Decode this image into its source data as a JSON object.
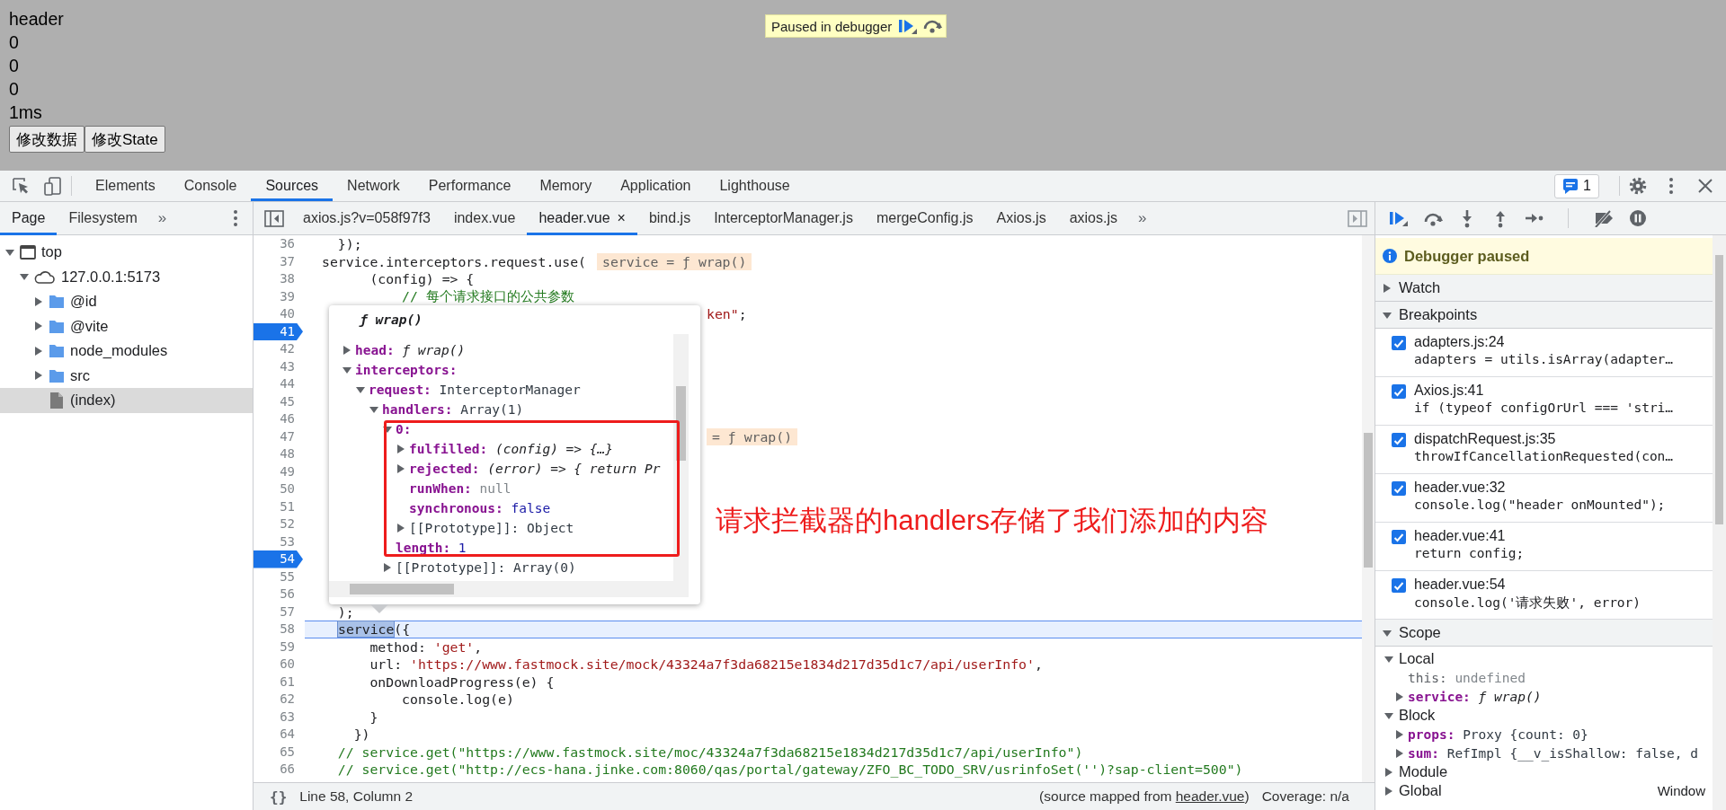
{
  "page": {
    "lines": [
      "header",
      "0",
      "0",
      "0",
      "1ms"
    ],
    "buttons": [
      "修改数据",
      "修改State"
    ],
    "paused_overlay": {
      "text": "Paused in debugger"
    }
  },
  "devtools": {
    "tabs": [
      {
        "label": "Elements",
        "selected": false
      },
      {
        "label": "Console",
        "selected": false
      },
      {
        "label": "Sources",
        "selected": true
      },
      {
        "label": "Network",
        "selected": false
      },
      {
        "label": "Performance",
        "selected": false
      },
      {
        "label": "Memory",
        "selected": false
      },
      {
        "label": "Application",
        "selected": false
      },
      {
        "label": "Lighthouse",
        "selected": false
      }
    ],
    "issues_count": "1"
  },
  "navigator": {
    "tabs": [
      {
        "label": "Page",
        "selected": true
      },
      {
        "label": "Filesystem",
        "selected": false
      }
    ],
    "more": "»",
    "tree": [
      {
        "label": "top",
        "kind": "frame",
        "expanded": true,
        "selected": false,
        "children": [
          {
            "label": "127.0.0.1:5173",
            "kind": "origin",
            "expanded": true,
            "selected": false,
            "children": [
              {
                "label": "@id",
                "kind": "folder",
                "expanded": false,
                "selected": false
              },
              {
                "label": "@vite",
                "kind": "folder",
                "expanded": false,
                "selected": false
              },
              {
                "label": "node_modules",
                "kind": "folder",
                "expanded": false,
                "selected": false
              },
              {
                "label": "src",
                "kind": "folder",
                "expanded": false,
                "selected": false
              },
              {
                "label": "(index)",
                "kind": "file",
                "selected": true
              }
            ]
          }
        ]
      }
    ]
  },
  "editor": {
    "tabs": [
      {
        "label": "axios.js?v=058f97f3",
        "selected": false
      },
      {
        "label": "index.vue",
        "selected": false
      },
      {
        "label": "header.vue",
        "selected": true,
        "close": "×"
      },
      {
        "label": "bind.js",
        "selected": false
      },
      {
        "label": "InterceptorManager.js",
        "selected": false
      },
      {
        "label": "mergeConfig.js",
        "selected": false
      },
      {
        "label": "Axios.js",
        "selected": false
      },
      {
        "label": "axios.js",
        "selected": false
      }
    ],
    "more": "»",
    "lines": [
      {
        "n": "36",
        "breakpoint": false,
        "current": false,
        "covered": false,
        "segments": [
          {
            "text": "  });",
            "kind": "plain"
          }
        ]
      },
      {
        "n": "37",
        "breakpoint": false,
        "current": false,
        "covered": false,
        "segments": [
          {
            "text": "service.interceptors.request.use(",
            "kind": "plain"
          }
        ],
        "inline_value": "service = ƒ wrap()"
      },
      {
        "n": "38",
        "breakpoint": false,
        "current": false,
        "covered": false,
        "segments": [
          {
            "text": "      (config) => {",
            "kind": "plain"
          }
        ]
      },
      {
        "n": "39",
        "breakpoint": false,
        "current": false,
        "covered": false,
        "segments": [
          {
            "text": "          // 每个请求接口的公共参数",
            "kind": "comment"
          }
        ]
      },
      {
        "n": "40",
        "breakpoint": false,
        "current": false,
        "covered": true,
        "segments": [
          {
            "text": "ken\"",
            "kind": "string"
          },
          {
            "text": ";",
            "kind": "plain"
          }
        ]
      },
      {
        "n": "41",
        "breakpoint": true,
        "current": false
      },
      {
        "n": "42",
        "breakpoint": false,
        "current": false
      },
      {
        "n": "43",
        "breakpoint": false,
        "current": false
      },
      {
        "n": "44",
        "breakpoint": false,
        "current": false
      },
      {
        "n": "45",
        "breakpoint": false,
        "current": false
      },
      {
        "n": "46",
        "breakpoint": false,
        "current": false
      },
      {
        "n": "47",
        "breakpoint": false,
        "current": false,
        "covered": true,
        "inline_value": "= ƒ wrap()"
      },
      {
        "n": "48",
        "breakpoint": false,
        "current": false
      },
      {
        "n": "49",
        "breakpoint": false,
        "current": false
      },
      {
        "n": "50",
        "breakpoint": false,
        "current": false
      },
      {
        "n": "51",
        "breakpoint": false,
        "current": false
      },
      {
        "n": "52",
        "breakpoint": false,
        "current": false
      },
      {
        "n": "53",
        "breakpoint": false,
        "current": false
      },
      {
        "n": "54",
        "breakpoint": true,
        "current": false
      },
      {
        "n": "55",
        "breakpoint": false,
        "current": false
      },
      {
        "n": "56",
        "breakpoint": false,
        "current": false
      },
      {
        "n": "57",
        "breakpoint": false,
        "current": false,
        "covered": false,
        "segments": [
          {
            "text": "  );",
            "kind": "plain"
          }
        ]
      },
      {
        "n": "58",
        "breakpoint": false,
        "current": true,
        "covered": false,
        "segments": [
          {
            "text": "service",
            "kind": "selection"
          },
          {
            "text": "({",
            "kind": "plain"
          }
        ]
      },
      {
        "n": "59",
        "breakpoint": false,
        "current": false,
        "covered": false,
        "segments": [
          {
            "text": "      method: ",
            "kind": "plain"
          },
          {
            "text": "'get'",
            "kind": "string"
          },
          {
            "text": ",",
            "kind": "plain"
          }
        ]
      },
      {
        "n": "60",
        "breakpoint": false,
        "current": false,
        "covered": false,
        "segments": [
          {
            "text": "      url: ",
            "kind": "plain"
          },
          {
            "text": "'https://www.fastmock.site/mock/43324a7f3da68215e1834d217d35d1c7/api/userInfo'",
            "kind": "string"
          },
          {
            "text": ",",
            "kind": "plain"
          }
        ]
      },
      {
        "n": "61",
        "breakpoint": false,
        "current": false,
        "covered": false,
        "segments": [
          {
            "text": "      onDownloadProgress(e) {",
            "kind": "plain"
          }
        ]
      },
      {
        "n": "62",
        "breakpoint": false,
        "current": false,
        "covered": false,
        "segments": [
          {
            "text": "          console.log(e)",
            "kind": "plain"
          }
        ]
      },
      {
        "n": "63",
        "breakpoint": false,
        "current": false,
        "covered": false,
        "segments": [
          {
            "text": "      }",
            "kind": "plain"
          }
        ]
      },
      {
        "n": "64",
        "breakpoint": false,
        "current": false,
        "covered": false,
        "segments": [
          {
            "text": "    })",
            "kind": "plain"
          }
        ]
      },
      {
        "n": "65",
        "breakpoint": false,
        "current": false,
        "covered": false,
        "segments": [
          {
            "text": "  // service.get(\"https://www.fastmock.site/moc/43324a7f3da68215e1834d217d35d1c7/api/userInfo\")",
            "kind": "comment"
          }
        ]
      },
      {
        "n": "66",
        "breakpoint": false,
        "current": false,
        "covered": false,
        "segments": [
          {
            "text": "  // service.get(\"http://ecs-hana.jinke.com:8060/qas/portal/gateway/ZFO_BC_TODO_SRV/usrinfoSet('')?sap-client=500\")",
            "kind": "comment"
          }
        ]
      }
    ],
    "popover": {
      "title": "ƒ wrap()",
      "items": [
        {
          "key": "head:",
          "value": "ƒ wrap()",
          "kind": "function",
          "expanded": false
        },
        {
          "key": "interceptors:",
          "kind": "object",
          "expanded": true,
          "children": [
            {
              "key": "request:",
              "value": "InterceptorManager",
              "kind": "text",
              "expanded": true,
              "children": [
                {
                  "key": "handlers:",
                  "value": "Array(1)",
                  "kind": "text",
                  "expanded": true,
                  "children": [
                    {
                      "key": "0:",
                      "kind": "object",
                      "expanded": true,
                      "children": [
                        {
                          "key": "fulfilled:",
                          "value": "(config) => {…}",
                          "kind": "function",
                          "expanded": false
                        },
                        {
                          "key": "rejected:",
                          "value": "(error) => { return Pr",
                          "kind": "function",
                          "expanded": false
                        },
                        {
                          "key": "runWhen:",
                          "value": "null",
                          "kind": "null"
                        },
                        {
                          "key": "synchronous:",
                          "value": "false",
                          "kind": "boolean"
                        },
                        {
                          "key": "[[Prototype]]:",
                          "value": "Object",
                          "kind": "internal",
                          "expanded": false
                        }
                      ]
                    },
                    {
                      "key": "length:",
                      "value": "1",
                      "kind": "number"
                    },
                    {
                      "key": "[[Prototype]]:",
                      "value": "Array(0)",
                      "kind": "internal",
                      "expanded": false
                    }
                  ]
                }
              ]
            }
          ]
        }
      ]
    },
    "annotation": "请求拦截器的handlers存储了我们添加的内容"
  },
  "status_bar": {
    "pretty_print": "{}",
    "position": "Line 58, Column 2",
    "source_prefix": "(source mapped from ",
    "source_link": "header.vue",
    "source_suffix": ")",
    "coverage": "Coverage: n/a"
  },
  "debugger": {
    "banner": "Debugger paused",
    "panes": [
      {
        "kind": "watch",
        "title": "Watch",
        "expanded": false
      },
      {
        "kind": "breakpoints",
        "title": "Breakpoints",
        "expanded": true,
        "items": [
          {
            "location": "adapters.js:24",
            "code": "adapters = utils.isArray(adapter…",
            "checked": true
          },
          {
            "location": "Axios.js:41",
            "code": "if (typeof configOrUrl === 'stri…",
            "checked": true
          },
          {
            "location": "dispatchRequest.js:35",
            "code": "throwIfCancellationRequested(con…",
            "checked": true
          },
          {
            "location": "header.vue:32",
            "code": "console.log(\"header onMounted\");",
            "checked": true
          },
          {
            "location": "header.vue:41",
            "code": "return config;",
            "checked": true
          },
          {
            "location": "header.vue:54",
            "code": "console.log('请求失败', error)",
            "checked": true
          }
        ]
      },
      {
        "kind": "scope",
        "title": "Scope",
        "expanded": true,
        "groups": [
          {
            "title": "Local",
            "expanded": true,
            "items": [
              {
                "key": "this:",
                "value": "undefined",
                "kind": "undefined"
              },
              {
                "key": "service:",
                "value": "ƒ wrap()",
                "kind": "function",
                "expanded": false
              }
            ]
          },
          {
            "title": "Block",
            "expanded": true,
            "items": [
              {
                "key": "props:",
                "value": "Proxy {count: 0}",
                "kind": "text",
                "expanded": false
              },
              {
                "key": "sum:",
                "value": "RefImpl {__v_isShallow: false, d",
                "kind": "text",
                "expanded": false
              }
            ]
          },
          {
            "title": "Module",
            "expanded": false
          },
          {
            "title": "Global",
            "expanded": false,
            "value": "Window"
          }
        ]
      }
    ]
  }
}
